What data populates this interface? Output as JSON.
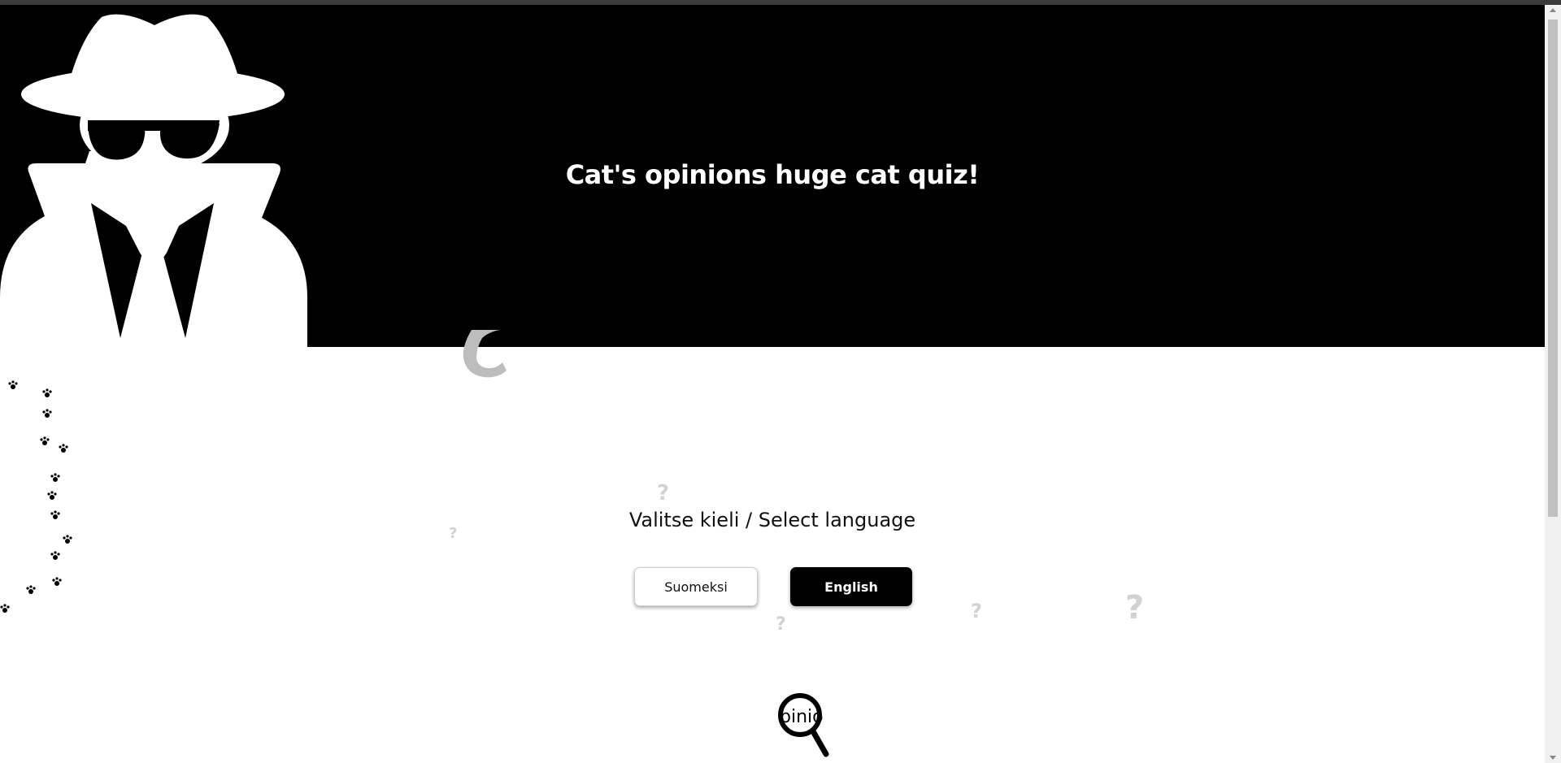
{
  "header": {
    "title": "Cat's opinions huge cat quiz!",
    "logo_icon": "spy-icon"
  },
  "language": {
    "prompt": "Valitse kieli / Select language",
    "finnish_label": "Suomeksi",
    "english_label": "English"
  },
  "footer": {
    "magnifier_icon": "magnifier-icon",
    "magnifier_text": "pinio"
  },
  "decorations": {
    "paw_icon": "paw-print-icon",
    "question_icon": "question-mark-icon",
    "question_glyph": "?"
  },
  "colors": {
    "header_bg": "#000000",
    "header_text": "#ffffff",
    "primary_button": "#000000",
    "secondary_button": "#ffffff"
  }
}
